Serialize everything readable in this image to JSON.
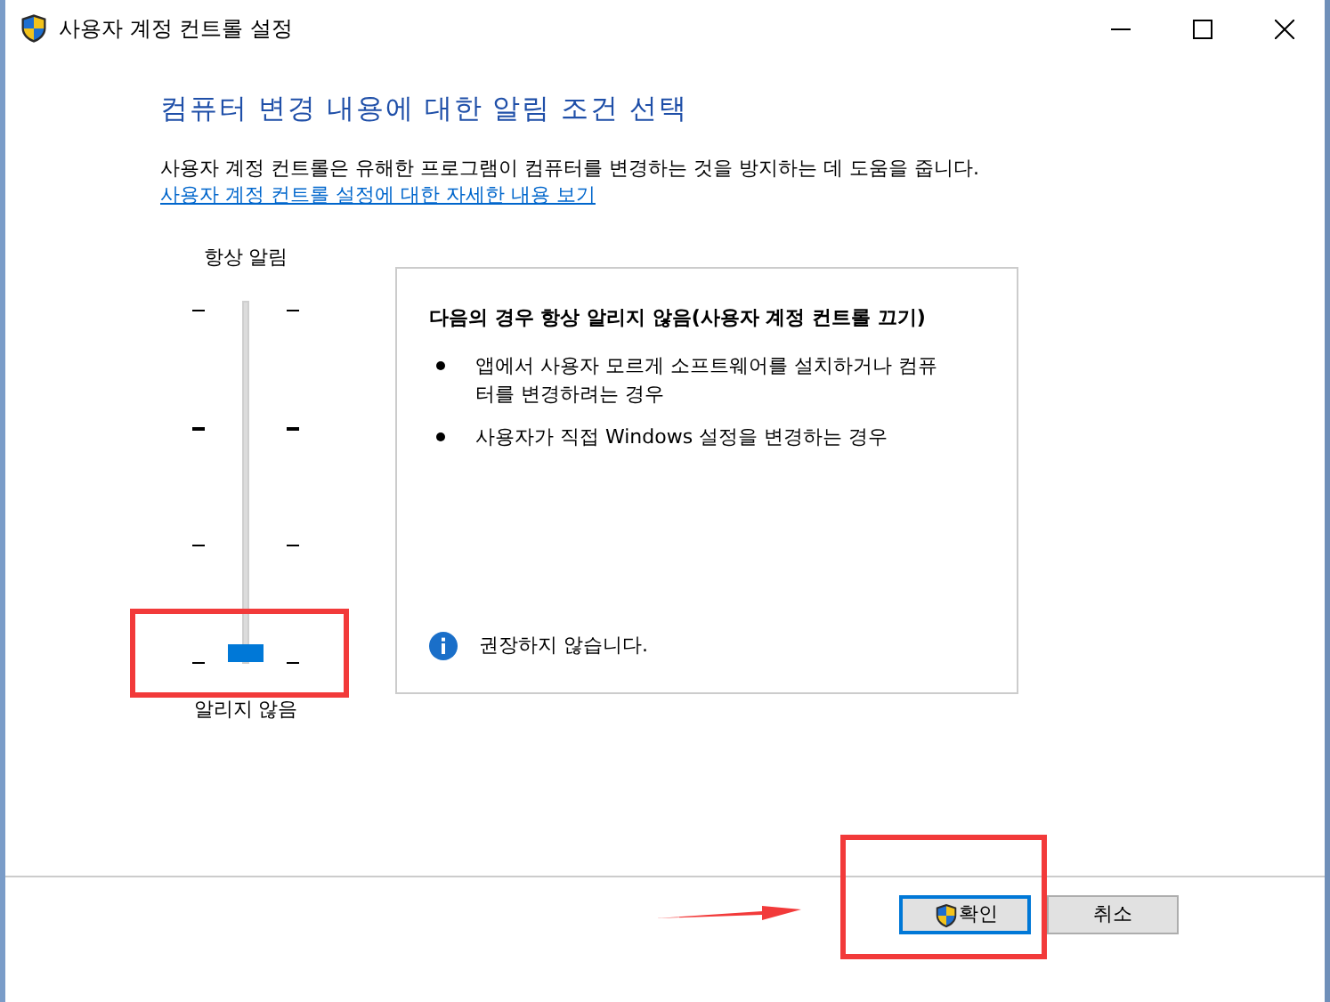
{
  "window": {
    "title": "사용자 계정 컨트롤 설정"
  },
  "heading": "컴퓨터 변경 내용에 대한 알림 조건 선택",
  "description": "사용자 계정 컨트롤은 유해한 프로그램이 컴퓨터를 변경하는 것을 방지하는 데 도움을 줍니다.",
  "link": "사용자 계정 컨트롤 설정에 대한 자세한 내용 보기",
  "slider": {
    "top_label": "항상 알림",
    "bottom_label": "알리지 않음",
    "level": 0
  },
  "info_panel": {
    "title": "다음의 경우 항상 알리지 않음(사용자 계정 컨트롤 끄기)",
    "bullets": [
      "앱에서 사용자 모르게 소프트웨어를 설치하거나 컴퓨터를 변경하려는 경우",
      "사용자가 직접 Windows 설정을 변경하는 경우"
    ],
    "note": "권장하지 않습니다."
  },
  "buttons": [
    {
      "label": "확인",
      "default": true,
      "shield": true
    },
    {
      "label": "취소",
      "default": false,
      "shield": false
    }
  ]
}
